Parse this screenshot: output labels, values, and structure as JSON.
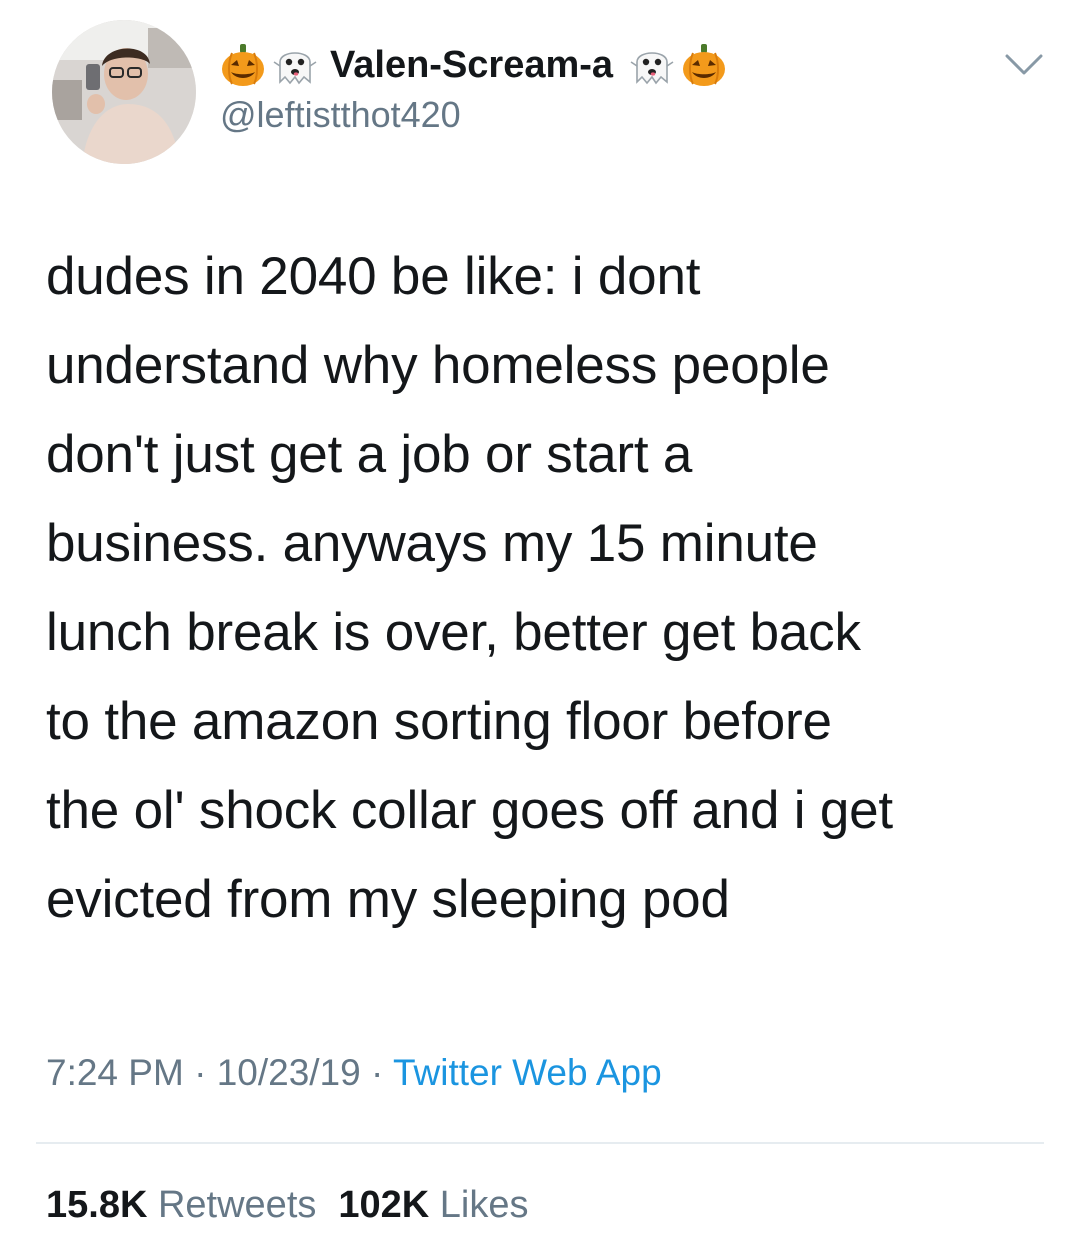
{
  "author": {
    "display_name": "Valen-Scream-a",
    "handle": "@leftistthot420",
    "name_icons_left": [
      "jack-o-lantern-icon",
      "ghost-icon"
    ],
    "name_icons_right": [
      "ghost-icon",
      "jack-o-lantern-icon"
    ]
  },
  "tweet": {
    "text": "dudes in 2040 be like: i dont\nunderstand why homeless people\ndon't just get a job or start a\nbusiness. anyways my 15 minute\nlunch break is over, better get back\nto the amazon sorting floor before\nthe ol' shock collar goes off and i get\nevicted from my sleeping pod"
  },
  "meta": {
    "time": "7:24 PM",
    "separator": " · ",
    "date": "10/23/19",
    "source": "Twitter Web App"
  },
  "stats": {
    "retweets_count": "15.8K",
    "retweets_label": "Retweets",
    "likes_count": "102K",
    "likes_label": "Likes"
  },
  "colors": {
    "text": "#14171a",
    "secondary": "#657786",
    "link": "#1b95e0",
    "divider": "#e6ecf0"
  }
}
